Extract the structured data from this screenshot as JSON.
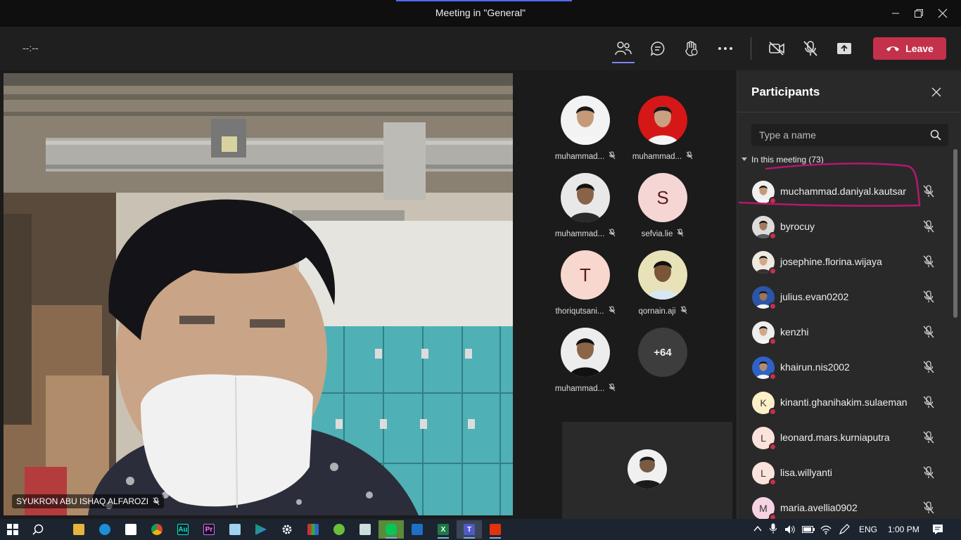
{
  "window": {
    "title": "Meeting in \"General\"",
    "controls": [
      "minimize",
      "restore",
      "close"
    ]
  },
  "toolbar": {
    "timer": "--:--",
    "buttons": [
      "participants-icon",
      "chat-icon",
      "raise-hand-icon",
      "more-icon",
      "camera-off-icon",
      "mic-off-icon",
      "share-screen-icon"
    ],
    "leave_label": "Leave"
  },
  "main_video": {
    "name": "SYUKRON ABU ISHAQ ALFAROZI",
    "muted": true
  },
  "gallery": {
    "tiles": [
      {
        "name": "muhammad...",
        "avatar": "photo",
        "muted": true
      },
      {
        "name": "muhammad...",
        "avatar": "photo",
        "muted": true
      },
      {
        "name": "muhammad...",
        "avatar": "photo",
        "muted": true
      },
      {
        "name": "sefvia.lie",
        "avatar": "S",
        "muted": true
      },
      {
        "name": "thoriqutsani...",
        "avatar": "T",
        "muted": true
      },
      {
        "name": "qornain.aji",
        "avatar": "photo",
        "muted": true
      },
      {
        "name": "muhammad...",
        "avatar": "photo",
        "muted": true
      }
    ],
    "more_count": "+64"
  },
  "participants": {
    "title": "Participants",
    "search_placeholder": "Type a name",
    "section_label": "In this meeting (73)",
    "list": [
      {
        "name": "muchammad.daniyal.kautsar",
        "avatar": "photo"
      },
      {
        "name": "byrocuy",
        "avatar": "photo"
      },
      {
        "name": "josephine.florina.wijaya",
        "avatar": "photo"
      },
      {
        "name": "julius.evan0202",
        "avatar": "photo"
      },
      {
        "name": "kenzhi",
        "avatar": "photo"
      },
      {
        "name": "khairun.nis2002",
        "avatar": "photo"
      },
      {
        "name": "kinanti.ghanihakim.sulaeman",
        "avatar": "K"
      },
      {
        "name": "leonard.mars.kurniaputra",
        "avatar": "L"
      },
      {
        "name": "lisa.willyanti",
        "avatar": "L"
      },
      {
        "name": "maria.avellia0902",
        "avatar": "M"
      }
    ]
  },
  "colors": {
    "leave_red": "#c4314b",
    "accent": "#7f85f5",
    "annotation": "#b5176e"
  },
  "taskbar": {
    "language": "ENG",
    "time": "1:00 PM"
  }
}
